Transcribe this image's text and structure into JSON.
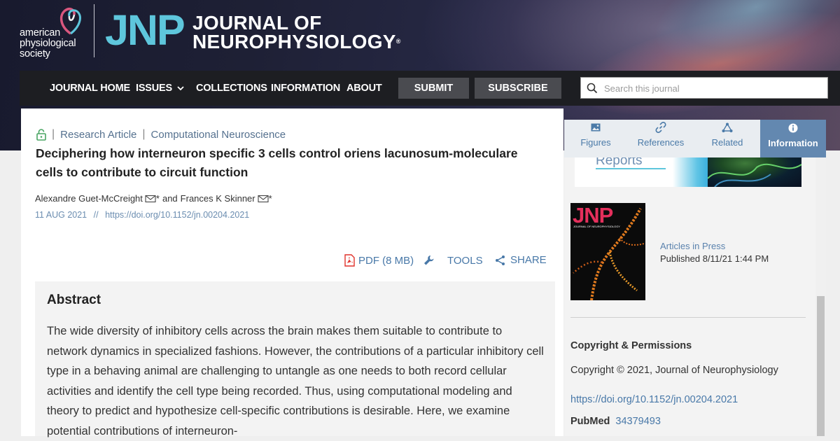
{
  "publisher": {
    "line1": "american",
    "line2": "physiological",
    "line3": "society"
  },
  "journal": {
    "abbrev": "JNP",
    "title_line1": "JOURNAL OF",
    "title_line2": "NEUROPHYSIOLOGY",
    "tm": "®"
  },
  "nav": {
    "items": [
      "JOURNAL HOME",
      "ISSUES",
      "COLLECTIONS",
      "INFORMATION",
      "ABOUT"
    ],
    "submit": "SUBMIT",
    "subscribe": "SUBSCRIBE",
    "search_placeholder": "Search this journal"
  },
  "article": {
    "type": "Research Article",
    "section": "Computational Neuroscience",
    "title": "Deciphering how interneuron specific 3 cells control oriens lacunosum-moleculare cells to contribute to circuit function",
    "author1": "Alexandre Guet-McCreight",
    "author2": "Frances K Skinner",
    "and": "and",
    "asterisk": "*",
    "date": "11 AUG 2021",
    "date_sep": "//",
    "doi": "https://doi.org/10.1152/jn.00204.2021"
  },
  "tools": {
    "pdf": "PDF (8 MB)",
    "tools": "TOOLS",
    "share": "SHARE"
  },
  "abstract": {
    "heading": "Abstract",
    "text": "The wide diversity of inhibitory cells across the brain makes them suitable to contribute to network dynamics in specialized fashions. However, the contributions of a particular inhibitory cell type in a behaving animal are challenging to untangle as one needs to both record cellular activities and identify the cell type being recorded. Thus, using computational modeling and theory to predict and hypothesize cell-specific contributions is desirable. Here, we examine potential contributions of interneuron-"
  },
  "sidebar": {
    "tabs": [
      {
        "label": "Figures",
        "icon": "image-icon"
      },
      {
        "label": "References",
        "icon": "link-icon"
      },
      {
        "label": "Related",
        "icon": "network-icon"
      },
      {
        "label": "Information",
        "icon": "info-icon"
      }
    ],
    "active_tab": "Information",
    "ad_text": "Reports",
    "cover_logo": "JNP",
    "cover_sub": "JOURNAL OF NEUROPHYSIOLOGY",
    "aip": "Articles in Press",
    "published": "Published 8/11/21 1:44 PM",
    "copyright_heading": "Copyright & Permissions",
    "copyright_text": "Copyright © 2021, Journal of Neurophysiology",
    "doi": "https://doi.org/10.1152/jn.00204.2021",
    "pubmed_label": "PubMed",
    "pubmed_id": "34379493"
  },
  "colors": {
    "accent": "#5ec6dc",
    "link": "#4878a8",
    "nav_bg": "#1d1e22",
    "active_tab": "#6388b0",
    "pdf_red": "#e0322b"
  }
}
